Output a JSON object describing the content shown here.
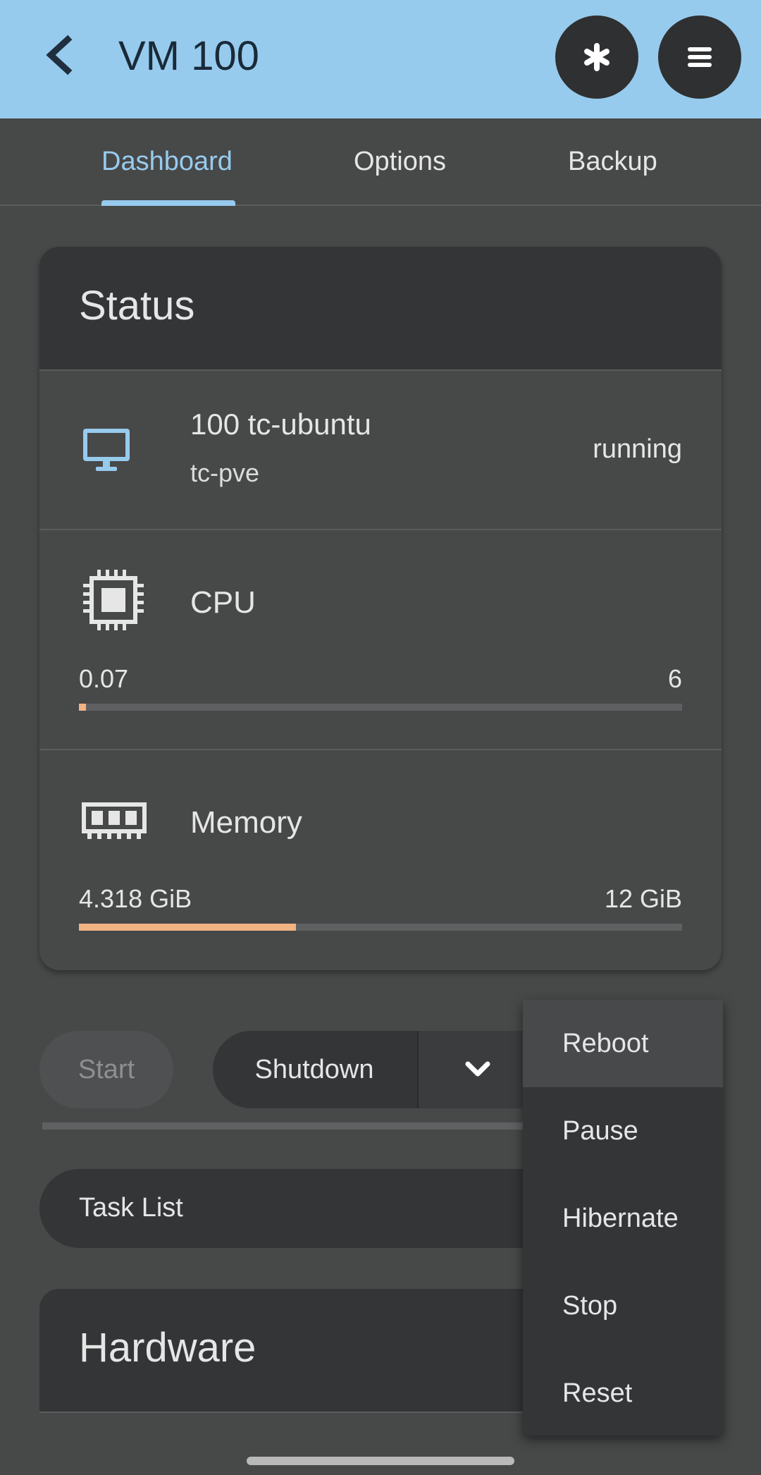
{
  "header": {
    "title": "VM 100",
    "back_icon": "chevron-left-icon",
    "action1_icon": "asterisk-icon",
    "action2_icon": "hamburger-menu-icon",
    "background_color": "#97cbee"
  },
  "tabs": [
    {
      "label": "Dashboard",
      "active": true
    },
    {
      "label": "Options",
      "active": false
    },
    {
      "label": "Backup",
      "active": false
    }
  ],
  "status": {
    "title": "Status",
    "vm": {
      "name": "100 tc-ubuntu",
      "node": "tc-pve",
      "state": "running",
      "icon": "monitor-icon"
    },
    "cpu": {
      "label": "CPU",
      "used": "0.07",
      "max": "6",
      "fraction": 0.012,
      "icon": "cpu-chip-icon"
    },
    "memory": {
      "label": "Memory",
      "used": "4.318 GiB",
      "max": "12 GiB",
      "fraction": 0.36,
      "icon": "memory-module-icon"
    }
  },
  "actions": {
    "start_label": "Start",
    "shutdown_label": "Shutdown",
    "dropdown_icon": "chevron-down-icon"
  },
  "menu": {
    "items": [
      {
        "label": "Reboot",
        "hover": true
      },
      {
        "label": "Pause",
        "hover": false
      },
      {
        "label": "Hibernate",
        "hover": false
      },
      {
        "label": "Stop",
        "hover": false
      },
      {
        "label": "Reset",
        "hover": false
      }
    ]
  },
  "task_list": {
    "label": "Task List"
  },
  "hardware": {
    "title": "Hardware"
  },
  "colors": {
    "accent": "#97cbee",
    "bar_fill": "#f2b384"
  }
}
